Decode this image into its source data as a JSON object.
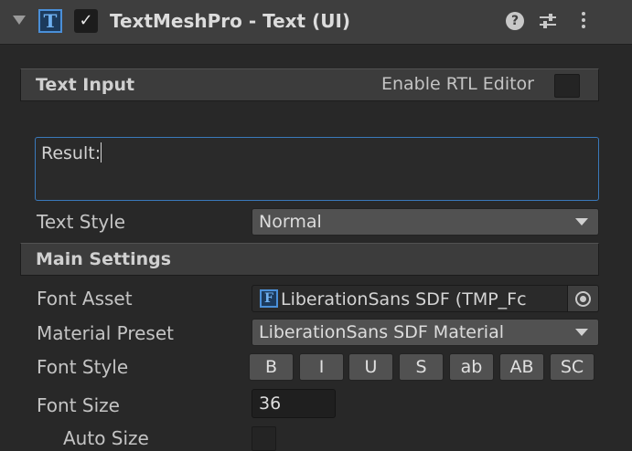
{
  "header": {
    "tmp_icon": "T",
    "enabled": true,
    "check_glyph": "✓",
    "title": "TextMeshPro - Text (UI)",
    "help_glyph": "?",
    "icons": [
      "foldout-arrow-icon",
      "textmeshpro-icon",
      "checkbox-icon",
      "help-icon",
      "presets-icon",
      "kebab-menu-icon"
    ]
  },
  "text_input": {
    "section_label": "Text Input",
    "rtl_label": "Enable RTL Editor",
    "rtl_enabled": false,
    "value": "Result:"
  },
  "text_style": {
    "label": "Text Style",
    "value": "Normal"
  },
  "main_settings": {
    "section_label": "Main Settings",
    "font_asset": {
      "label": "Font Asset",
      "icon": "F",
      "value": "LiberationSans SDF (TMP_Fc"
    },
    "material_preset": {
      "label": "Material Preset",
      "value": "LiberationSans SDF Material"
    },
    "font_style": {
      "label": "Font Style",
      "buttons": [
        "B",
        "I",
        "U",
        "S",
        "ab",
        "AB",
        "SC"
      ]
    },
    "font_size": {
      "label": "Font Size",
      "value": "36"
    },
    "auto_size": {
      "label": "Auto Size",
      "enabled": false
    }
  },
  "colors": {
    "background": "#282828",
    "header": "#3e3e3e",
    "accent": "#3a79bb",
    "button": "#515151",
    "text": "#c4c4c4"
  }
}
